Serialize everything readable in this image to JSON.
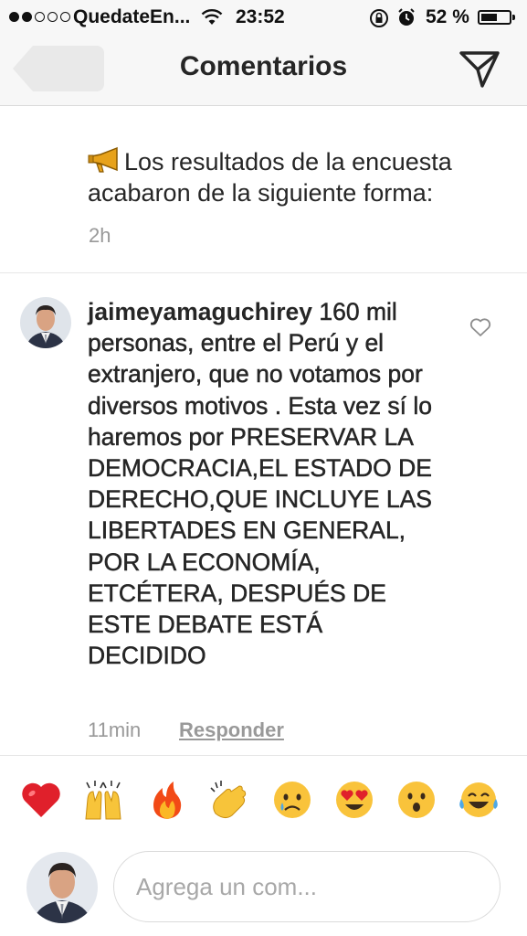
{
  "status_bar": {
    "carrier": "QuedateEn...",
    "time": "23:52",
    "battery_percent": "52 %",
    "battery_level": 0.52,
    "signal_bars_filled": 2,
    "signal_bars_total": 5
  },
  "nav": {
    "title": "Comentarios",
    "back_icon": "back-arrow-icon",
    "send_icon": "paper-plane-icon"
  },
  "caption": {
    "icon": "megaphone-icon",
    "text": "Los resultados de la encuesta acabaron de la siguiente forma:",
    "time": "2h"
  },
  "comment": {
    "username": "jaimeyamaguchirey",
    "text": "160 mil personas, entre el Perú y el extranjero, que no votamos por diversos motivos . Esta vez sí lo haremos por PRESERVAR LA DEMOCRACIA,EL ESTADO DE DERECHO,QUE INCLUYE LAS LIBERTADES EN GENERAL, POR LA ECONOMÍA, ETCÉTERA, DESPUÉS DE ESTE DEBATE ESTÁ DECIDIDO",
    "time": "11min",
    "reply_label": "Responder"
  },
  "emoji_row": [
    {
      "name": "red-heart",
      "glyph": "❤️"
    },
    {
      "name": "raising-hands",
      "glyph": "🙌"
    },
    {
      "name": "fire",
      "glyph": "🔥"
    },
    {
      "name": "clapping-hands",
      "glyph": "👏"
    },
    {
      "name": "crying-face",
      "glyph": "😢"
    },
    {
      "name": "heart-eyes",
      "glyph": "😍"
    },
    {
      "name": "surprised-face",
      "glyph": "😮"
    },
    {
      "name": "tears-of-joy",
      "glyph": "😂"
    }
  ],
  "composer": {
    "placeholder": "Agrega un com..."
  },
  "colors": {
    "text": "#262626",
    "secondary": "#999999",
    "divider": "#e6e6e6",
    "bar_bg": "#f7f7f7"
  }
}
